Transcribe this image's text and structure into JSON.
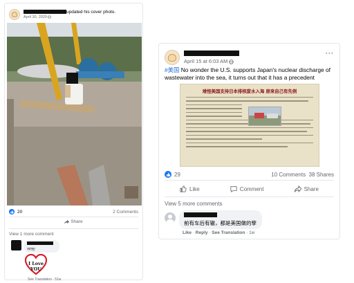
{
  "left_post": {
    "date": "April 30, 2020",
    "action_text": "updated his cover photo.",
    "reactions_count": "20",
    "comments_count": "2 Comments",
    "share_label": "Share",
    "view_more": "View 1 more comment",
    "comment": {
      "text": "আহা",
      "sticker_text": "I Love YOU",
      "see_translation": "See Translation",
      "time": "51w"
    }
  },
  "right_post": {
    "date": "April 15 at 6:03 AM",
    "hashtag": "#美国",
    "body": "No wonder the U.S. supports Japan's nuclear discharge of wastewater into the sea, it turns out that it has a precedent",
    "article_title": "难怪美国支持日本排核废水入海 原来自己有先例",
    "reactions_count": "29",
    "comments_count": "10 Comments",
    "shares_count": "38 Shares",
    "actions": {
      "like": "Like",
      "comment": "Comment",
      "share": "Share"
    },
    "view_more": "View 5 more comments",
    "comment": {
      "text": "前有车后有辙，都是美国做的孽",
      "like": "Like",
      "reply": "Reply",
      "see_translation": "See Translation",
      "time": "1w"
    }
  },
  "icons": [
    "like-reaction-icon",
    "share-icon",
    "thumbs-up-icon",
    "comment-icon",
    "globe-icon",
    "more-options-icon"
  ],
  "colors": {
    "link": "#216fdb",
    "like_blue": "#1877f2",
    "muted": "#65676b",
    "bubble": "#f0f2f5"
  }
}
